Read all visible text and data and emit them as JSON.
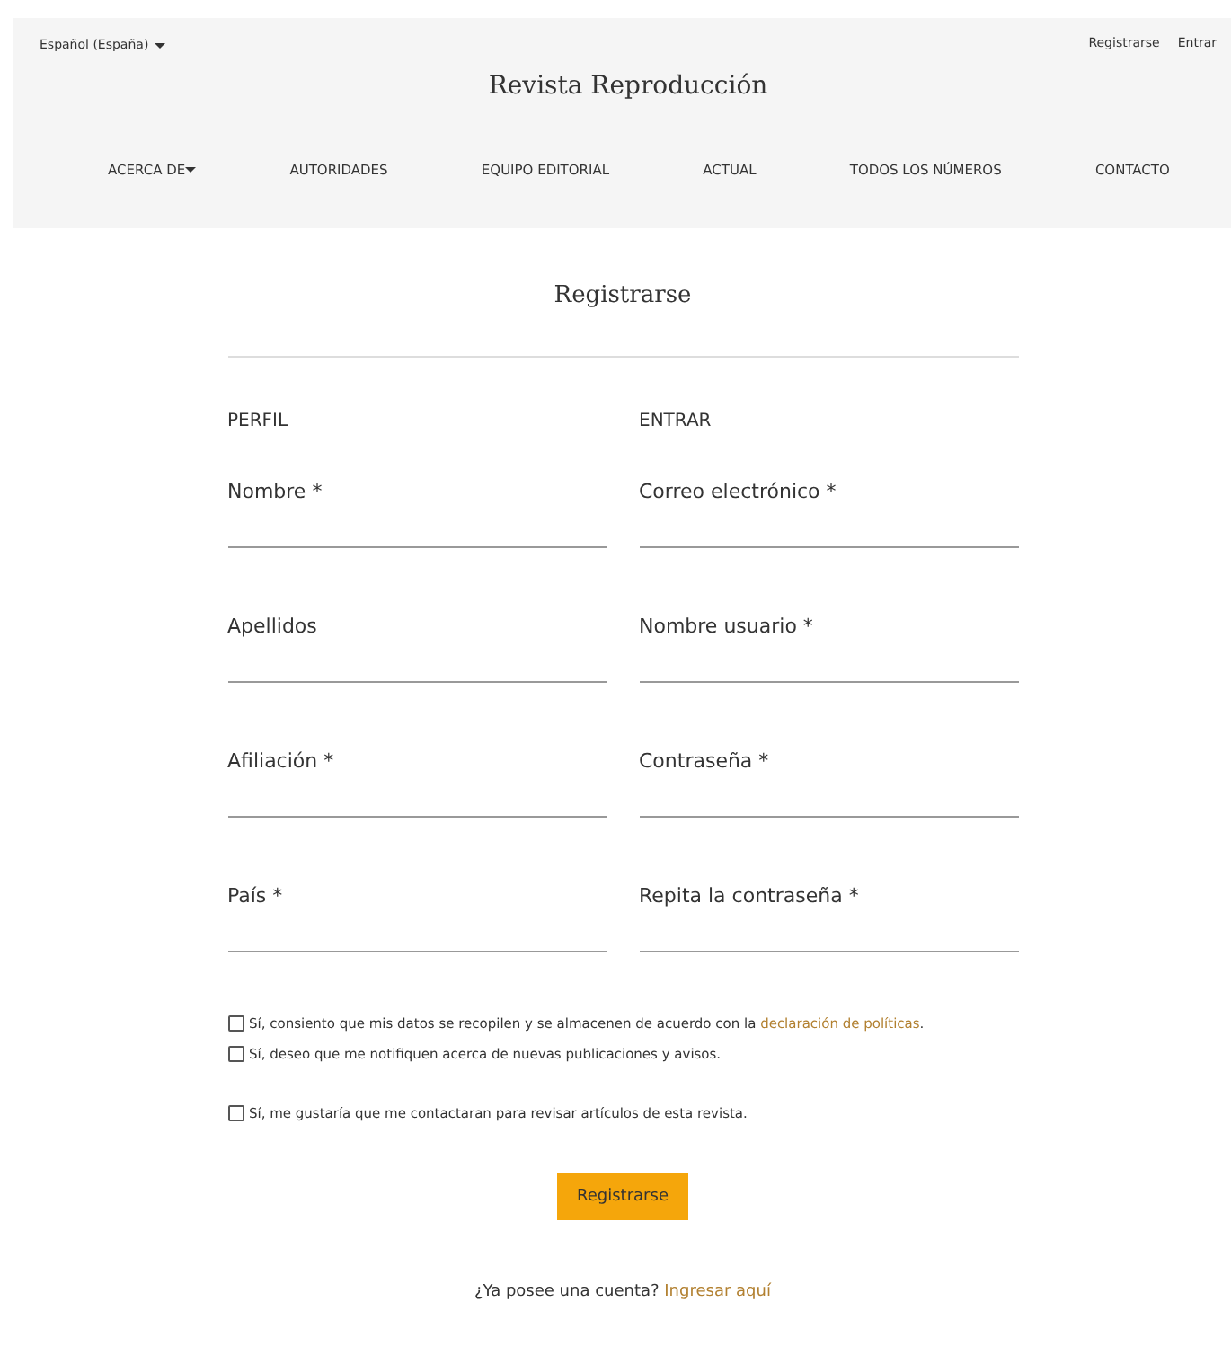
{
  "language": {
    "label": "Español (España)"
  },
  "user_links": [
    "Registrarse",
    "Entrar"
  ],
  "site_title": "Revista Reproducción",
  "nav": [
    {
      "label": "ACERCA DE",
      "dropdown": true
    },
    {
      "label": "AUTORIDADES",
      "dropdown": false
    },
    {
      "label": "EQUIPO EDITORIAL",
      "dropdown": false
    },
    {
      "label": "ACTUAL",
      "dropdown": false
    },
    {
      "label": "TODOS LOS NÚMEROS",
      "dropdown": false
    },
    {
      "label": "CONTACTO",
      "dropdown": false
    }
  ],
  "page_title": "Registrarse",
  "sections": [
    {
      "heading": "PERFIL",
      "fields": [
        "Nombre *",
        "Apellidos",
        "Afiliación *",
        "País *"
      ]
    },
    {
      "heading": "ENTRAR",
      "fields": [
        "Correo electrónico *",
        "Nombre usuario *",
        "Contraseña *",
        "Repita la contraseña *"
      ]
    }
  ],
  "consents": [
    {
      "text": "Sí, consiento que mis datos se recopilen y se almacenen de acuerdo con la",
      "link": "declaración de políticas",
      "after": ".",
      "checked": false
    },
    {
      "text": "Sí, deseo que me notifiquen acerca de nuevas publicaciones y avisos.",
      "checked": false
    },
    {
      "text": "Sí, me gustaría que me contactaran para revisar artículos de esta revista.",
      "checked": false
    }
  ],
  "submit": "Registrarse",
  "login_prompt": {
    "text": "¿Ya posee una cuenta?",
    "link": "Ingresar aquí"
  }
}
